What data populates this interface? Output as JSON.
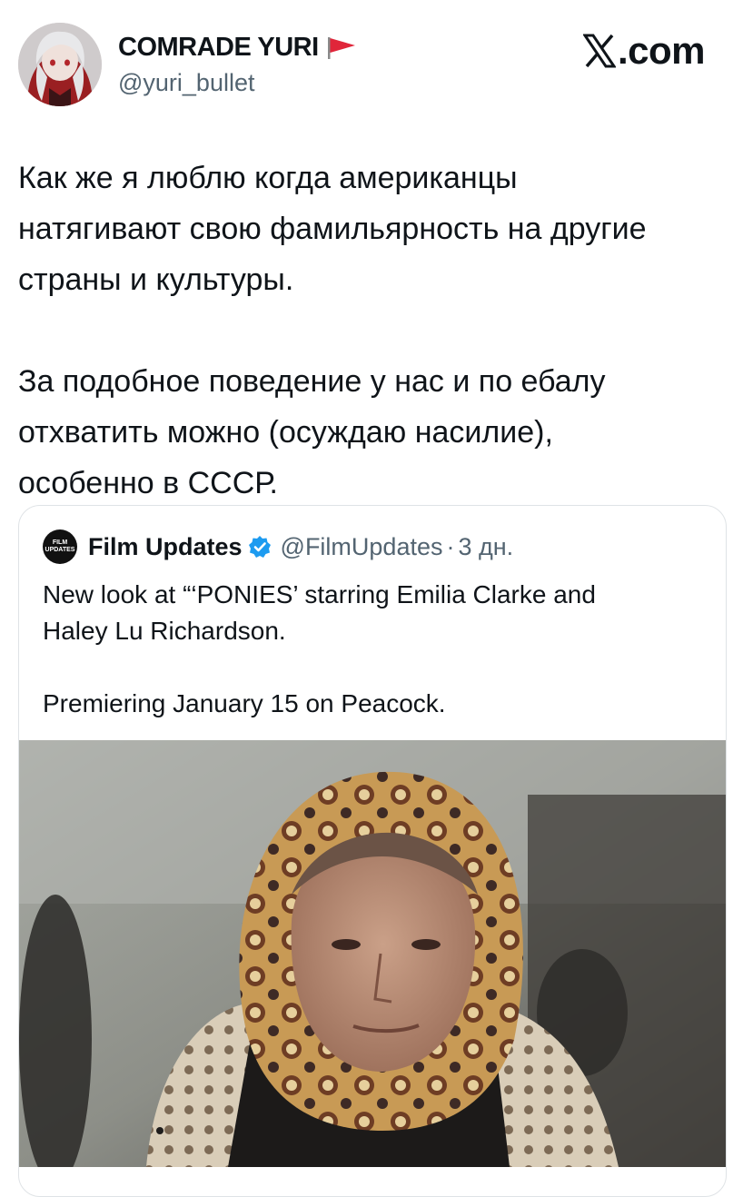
{
  "author": {
    "name": "COMRADE YURI",
    "handle": "@yuri_bullet",
    "avatar_icon": "anime-avatar",
    "flag_icon": "red-flag-icon"
  },
  "site": {
    "logo": ".com",
    "logo_icon": "x-logo-icon"
  },
  "tweet": {
    "text": "Как же я люблю когда американцы\nнатягивают свою фамильярность на другие\nстраны и культуры.\n\nЗа подобное поведение у нас и по ебалу\nотхватить можно (осуждаю насилие),\nособенно в СССР."
  },
  "quote": {
    "avatar_text": "FILM\nUPDATES",
    "name": "Film Updates",
    "verified_icon": "verified-badge-icon",
    "verified_color": "#1d9bf0",
    "handle": "@FilmUpdates",
    "separator": "·",
    "time": "3 дн.",
    "text": "New look at “‘PONIES’ starring Emilia Clarke and\nHaley Lu Richardson.\n\nPremiering January 15 on Peacock.",
    "image": "movie-still-woman-in-headscarf"
  }
}
